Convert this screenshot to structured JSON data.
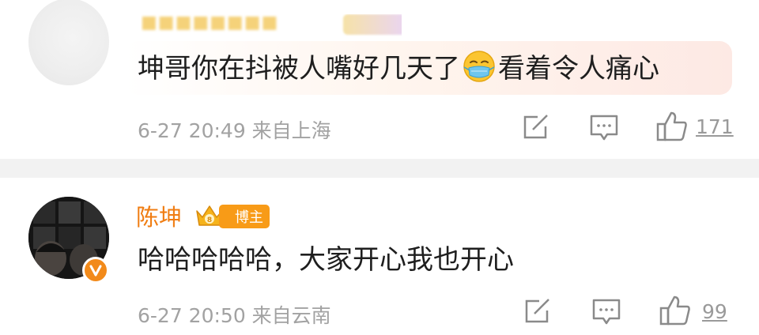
{
  "comments": [
    {
      "name": "",
      "text_before_emoji": "坤哥你在抖被人嘴好几天了",
      "emoji": "face-with-medical-mask-emoji",
      "text_after_emoji": "看着令人痛心",
      "meta": "6-27 20:49 来自上海",
      "likes": "171"
    },
    {
      "name": "陈坤",
      "badge_label": "博主",
      "text": "哈哈哈哈哈，大家开心我也开心",
      "meta": "6-27 20:50 来自云南",
      "likes": "99"
    }
  ],
  "colors": {
    "username_orange": "#f07d12",
    "blogger_badge": "#f89b17",
    "meta_gray": "#a2a2a2",
    "divider": "#f2f2f2"
  }
}
